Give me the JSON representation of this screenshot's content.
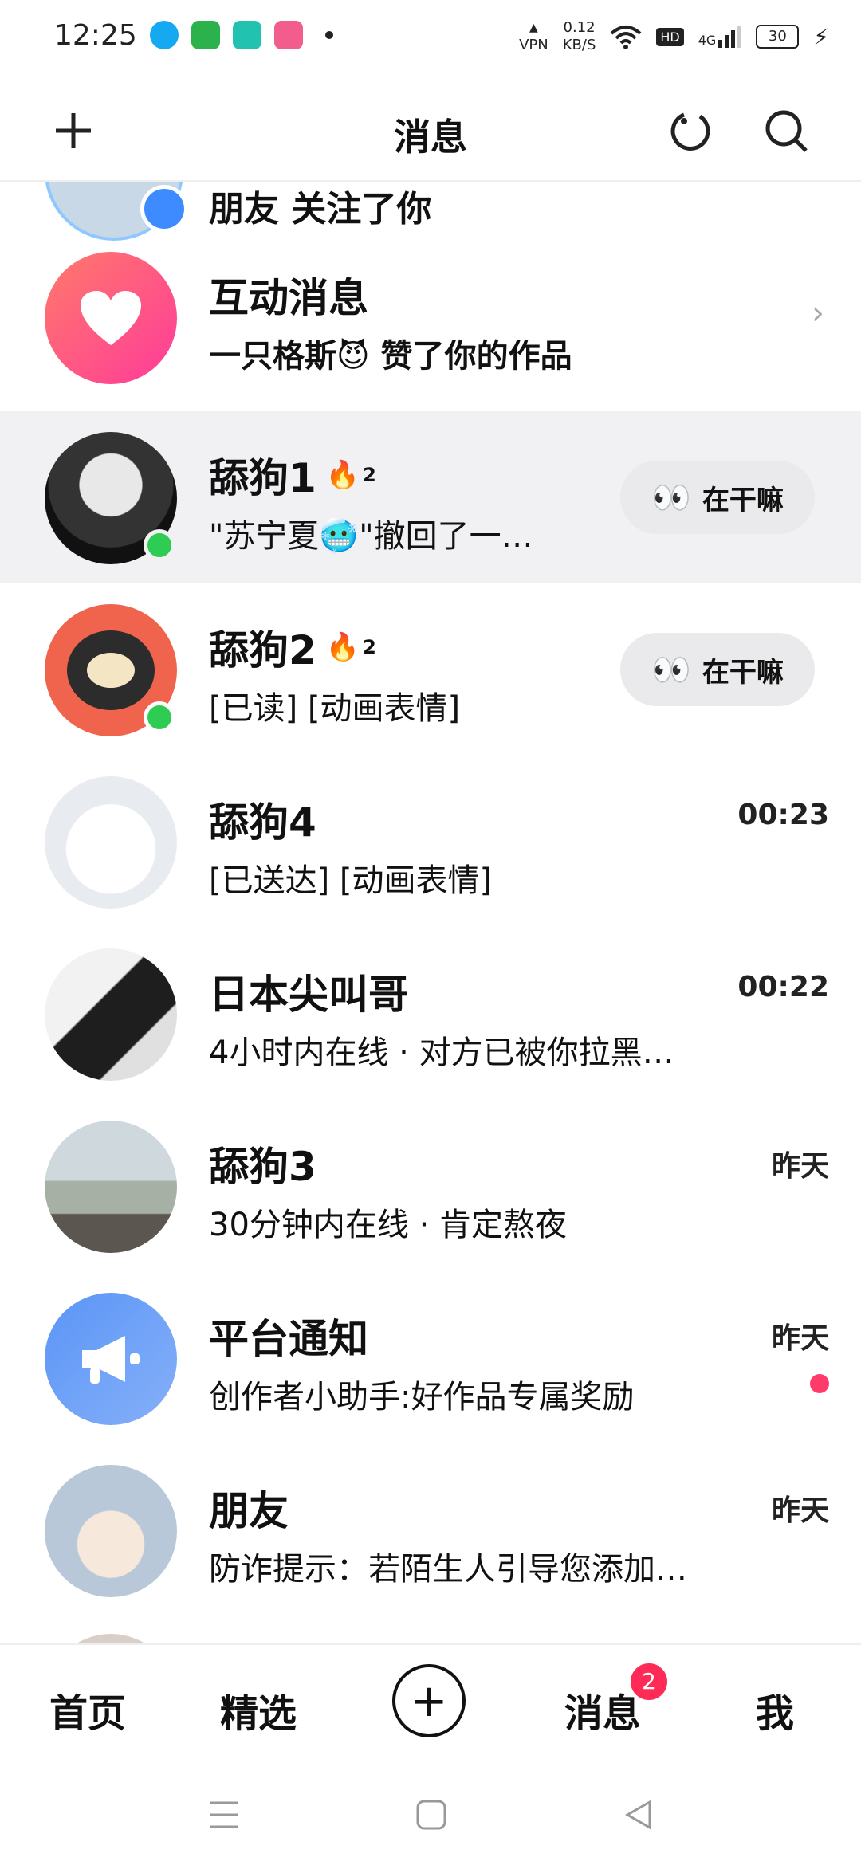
{
  "status_bar": {
    "time": "12:25",
    "vpn": "VPN",
    "speed_value": "0.12",
    "speed_unit": "KB/S",
    "hd": "HD",
    "network": "4G",
    "battery": "30"
  },
  "header": {
    "title": "消息",
    "icons": [
      "plus-icon",
      "refresh-icon",
      "search-icon"
    ]
  },
  "partial_row": {
    "preview": "朋友 关注了你"
  },
  "interactions": {
    "title": "互动消息",
    "preview": "一只格斯😈 赞了你的作品",
    "color_start": "#ff6f6f",
    "color_end": "#ff3b9a"
  },
  "chats": [
    {
      "name": "舔狗1",
      "flame": "2",
      "preview": "\"苏宁夏🥶\"撤回了一…",
      "action": "在干嘛",
      "online": true
    },
    {
      "name": "舔狗2",
      "flame": "2",
      "preview": "[已读] [动画表情]",
      "action": "在干嘛",
      "online": true
    },
    {
      "name": "舔狗4",
      "preview": "[已送达] [动画表情]",
      "time": "00:23"
    },
    {
      "name": "日本尖叫哥",
      "preview": "4小时内在线 · 对方已被你拉黑…",
      "time": "00:22"
    },
    {
      "name": "舔狗3",
      "preview": "30分钟内在线 · 肯定熬夜",
      "time": "昨天"
    },
    {
      "name": "平台通知",
      "preview": "创作者小助手:好作品专属奖励",
      "time": "昨天"
    },
    {
      "name": "朋友",
      "preview": "防诈提示：若陌生人引导您添加…",
      "time": "昨天"
    }
  ],
  "bottom_nav": {
    "home": "首页",
    "featured": "精选",
    "messages": "消息",
    "messages_badge": "2",
    "me": "我"
  },
  "colors": {
    "online": "#2ecc52",
    "badge": "#ff2a55",
    "notice_blue": "#6f9ff5"
  }
}
